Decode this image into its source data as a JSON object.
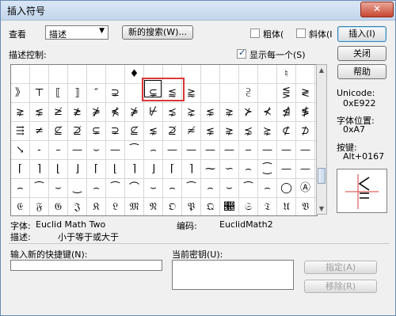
{
  "window": {
    "title": "插入符号",
    "close_glyph": "✕"
  },
  "toolbar": {
    "view_label": "查看",
    "view_value": "描述",
    "new_search": "新的搜索(W)...",
    "bold": "粗体(",
    "italic": "斜体(I",
    "insert": "插入(I)"
  },
  "controls": {
    "describe_label": "描述控制:",
    "show_one": "显示每一个(S)",
    "close": "关闭",
    "help": "帮助"
  },
  "grid": {
    "rows": [
      [
        "",
        "",
        "",
        "",
        "",
        "",
        "♦",
        "",
        "",
        "",
        "",
        "",
        "",
        "",
        "♮",
        "",
        "",
        "♯",
        "",
        "✢",
        "",
        "",
        "",
        "",
        "🙰"
      ],
      [
        "》",
        "⊤",
        "⟦",
        "⟧",
        "″",
        "⊋",
        "",
        "⊊",
        "⪅",
        "⪆",
        "",
        "",
        "⫔",
        "",
        "⋚",
        "≷",
        "≶",
        "",
        "⋛",
        "•"
      ],
      [
        "⋧",
        "⋦",
        "≱",
        "≵",
        "⋡",
        "⋠",
        "⋡",
        "⊬",
        "⋨",
        "⋩",
        "⋦",
        "⋧",
        "⊁",
        "⊀",
        "⋬",
        "≸",
        "⋭",
        "⋦",
        "⋧",
        "⋠"
      ],
      [
        "⇶",
        "≠",
        "⊈",
        "⊉",
        "⊊",
        "⊋",
        "⊈",
        "⋦",
        "⊉",
        "≉",
        "⋦",
        "⋧",
        "⋨",
        "⋩",
        "⊄",
        "⊅",
        "↮",
        "⇍",
        "⇏",
        "⇎"
      ],
      [
        "↘",
        "-",
        "–",
        "—",
        "⌣",
        "—",
        "⁀",
        "⌢",
        "—",
        "—",
        "—",
        "—",
        "‒",
        "—",
        "—",
        "—",
        "—",
        "‿",
        "‿",
        "⁔"
      ],
      [
        "⌈",
        "⌉",
        "⌊",
        "⌋",
        "⌈",
        "⌊",
        "⌉",
        "⌋",
        "⌈",
        "⌉",
        "⁓",
        "∽",
        "⌢",
        "⁐",
        "—",
        "—",
        "—",
        "∼",
        "⌣",
        "⌢"
      ],
      [
        "⌢",
        "⁀",
        "⌣",
        "‿",
        "⌢",
        "⁀",
        "⌒",
        "⌣",
        "⌢",
        "⁀",
        "⌢",
        "⌣",
        "⁀",
        "⌢",
        "◯",
        "Ⓐ",
        "Ⓑ",
        "—",
        "—",
        "—"
      ],
      [
        "𝔈",
        "𝔉",
        "𝔊",
        "𝔍",
        "𝔎",
        "𝔏",
        "𝔐",
        "𝔑",
        "𝔒",
        "𝔓",
        "𝔔",
        "𝔕",
        "𝔖",
        "𝔗",
        "𝔘",
        "𝔙",
        "𝔚",
        "𝔛",
        "𝔜",
        "𝔜"
      ]
    ]
  },
  "side": {
    "unicode_label": "Unicode:",
    "unicode_value": "0xE922",
    "font_pos_label": "字体位置:",
    "font_pos_value": "0xA7",
    "key_label": "按键:",
    "key_value": "Alt+0167"
  },
  "info": {
    "font_label": "字体:",
    "font_value": "Euclid Math Two",
    "encoding_label": "编码:",
    "encoding_value": "EuclidMath2",
    "desc_label": "描述:",
    "desc_value": "小于等于或大于"
  },
  "shortcut": {
    "new_label": "输入新的快捷键(N):",
    "current_label": "当前密钥(U):",
    "assign": "指定(A)",
    "remove": "移除(R)"
  }
}
